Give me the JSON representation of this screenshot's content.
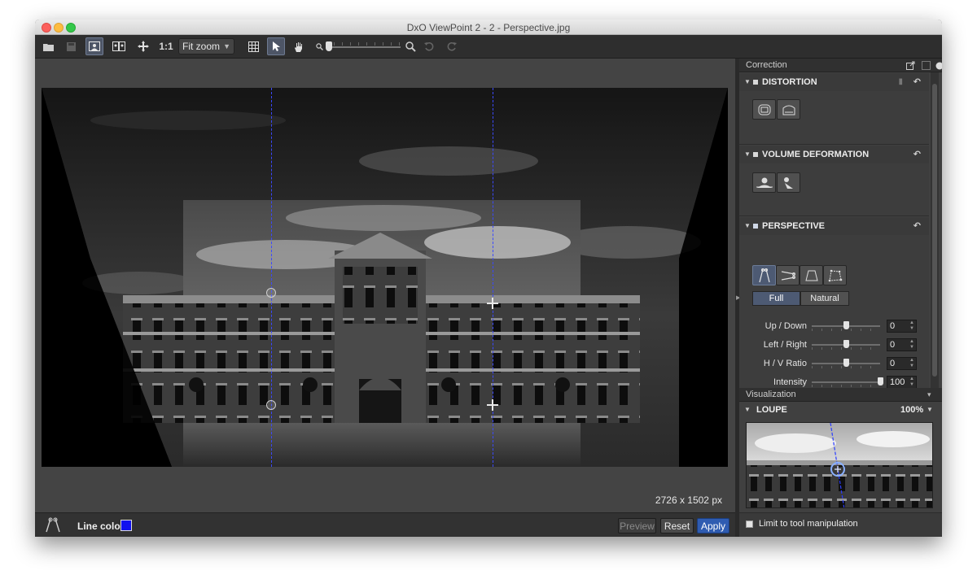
{
  "window": {
    "title": "DxO ViewPoint 2 - 2 - Perspective.jpg"
  },
  "toolbar": {
    "ratio_label": "1:1",
    "zoom_value": "Fit zoom"
  },
  "canvas": {
    "image_size": "2726 x 1502 px"
  },
  "bottom_bar": {
    "line_color_label": "Line color",
    "line_color": "#1111ee",
    "preview_label": "Preview",
    "reset_label": "Reset",
    "apply_label": "Apply"
  },
  "panel": {
    "correction_title": "Correction",
    "distortion_label": "DISTORTION",
    "volume_label": "VOLUME DEFORMATION",
    "perspective_label": "PERSPECTIVE",
    "mode_full": "Full",
    "mode_natural": "Natural",
    "sliders": [
      {
        "label": "Up / Down",
        "value": "0",
        "position": 0.5
      },
      {
        "label": "Left / Right",
        "value": "0",
        "position": 0.5
      },
      {
        "label": "H / V Ratio",
        "value": "0",
        "position": 0.5
      },
      {
        "label": "Intensity",
        "value": "100",
        "position": 1.0
      }
    ],
    "visualization_title": "Visualization",
    "loupe_label": "LOUPE",
    "loupe_zoom": "100%",
    "limit_label": "Limit to tool manipulation"
  },
  "colors": {
    "accent": "#2f5cb1",
    "guide_line": "#3b49ff"
  }
}
